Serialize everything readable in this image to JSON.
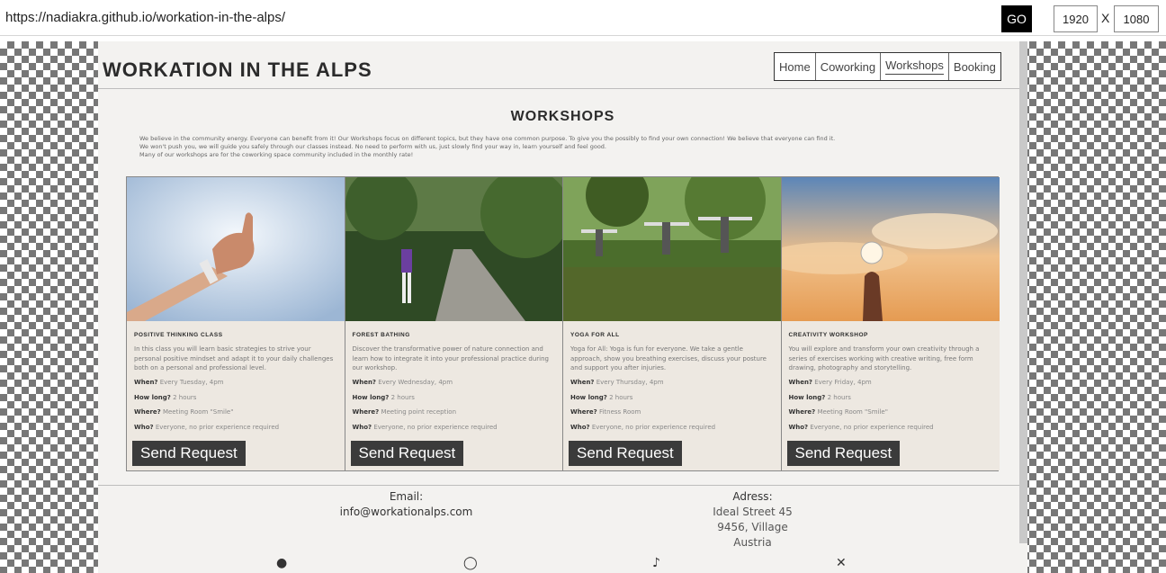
{
  "browser": {
    "url": "https://nadiakra.github.io/workation-in-the-alps/",
    "go_label": "GO",
    "width": "1920",
    "x_label": "X",
    "height": "1080"
  },
  "site": {
    "logo": "WORKATION IN THE ALPS",
    "nav": [
      "Home",
      "Coworking",
      "Workshops",
      "Booking"
    ],
    "active_nav": "Workshops",
    "section_title": "WORKSHOPS",
    "intro": [
      "We believe in the community energy. Everyone can benefit from it! Our Workshops focus on different topics, but they have one common purpose. To give you the possibly to find your own connection! We believe that everyone can find it.",
      "We won't push you, we will guide you safely through our classes instead. No need to perform with us, just slowly find your way in, learn yourself and feel good.",
      "Many of our workshops are for the coworking space community included in the monthly rate!"
    ],
    "cards": [
      {
        "title": "POSITIVE THINKING CLASS",
        "desc": "In this class you will learn basic strategies to strive your personal positive mindset and adapt it to your daily challenges both on a personal and professional level.",
        "when_label": "When?",
        "when": "Every Tuesday, 4pm",
        "howlong_label": "How long?",
        "howlong": "2 hours",
        "where_label": "Where?",
        "where": "Meeting Room \"Smile\"",
        "who_label": "Who?",
        "who": "Everyone, no prior experience required",
        "button": "Send Request",
        "image": "thumbs-up-photo"
      },
      {
        "title": "FOREST BATHING",
        "desc": "Discover the transformative power of nature connection and learn how to integrate it into your professional practice during our workshop.",
        "when_label": "When?",
        "when": "Every Wednesday, 4pm",
        "howlong_label": "How long?",
        "howlong": "2 hours",
        "where_label": "Where?",
        "where": "Meeting point reception",
        "who_label": "Who?",
        "who": "Everyone, no prior experience required",
        "button": "Send Request",
        "image": "forest-path-photo"
      },
      {
        "title": "YOGA FOR ALL",
        "desc": "Yoga for All: Yoga is fun for everyone. We take a gentle approach, show you breathing exercises, discuss your posture and support you after injuries.",
        "when_label": "When?",
        "when": "Every Thursday, 4pm",
        "howlong_label": "How long?",
        "howlong": "2 hours",
        "where_label": "Where?",
        "where": "Fitness Room",
        "who_label": "Who?",
        "who": "Everyone, no prior experience required",
        "button": "Send Request",
        "image": "outdoor-yoga-photo"
      },
      {
        "title": "CREATIVITY WORKSHOP",
        "desc": "You will explore and transform your own creativity through a series of exercises working with creative writing, free form drawing, photography and storytelling.",
        "when_label": "When?",
        "when": "Every Friday, 4pm",
        "howlong_label": "How long?",
        "howlong": "2 hours",
        "where_label": "Where?",
        "where": "Meeting Room \"Smile\"",
        "who_label": "Who?",
        "who": "Everyone, no prior experience required",
        "button": "Send Request",
        "image": "lightbulb-sky-photo"
      }
    ],
    "footer": {
      "email_label": "Email:",
      "email": "info@workationalps.com",
      "address_label": "Adress:",
      "address_lines": [
        "Ideal Street 45",
        "9456, Village",
        "Austria"
      ]
    },
    "social_icons": [
      "facebook-icon",
      "instagram-icon",
      "tiktok-icon",
      "x-icon"
    ]
  },
  "colors": {
    "card_bg": "#ede8e1",
    "button_bg": "#3b3b3b",
    "page_bg": "#f3f2f0"
  }
}
